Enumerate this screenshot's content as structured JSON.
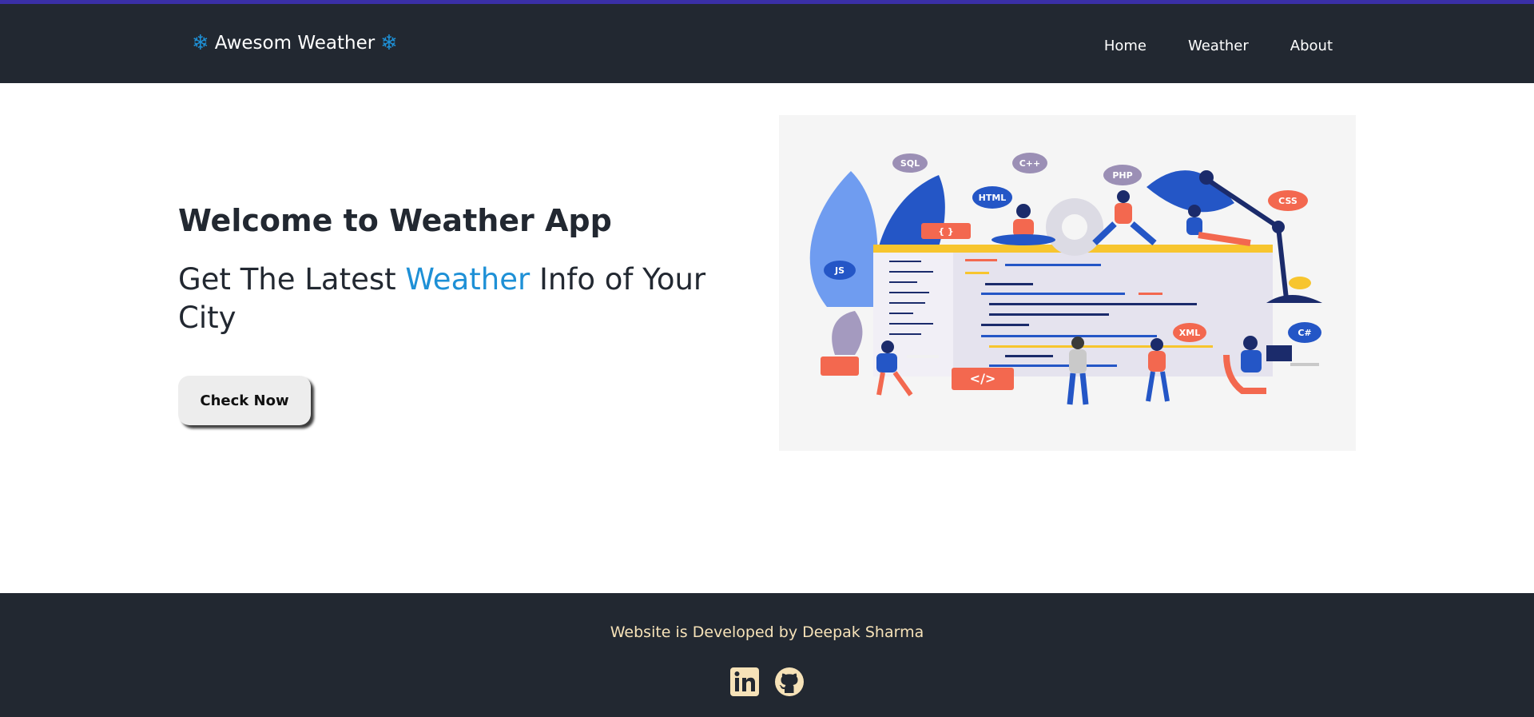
{
  "header": {
    "brand": "Awesom Weather",
    "brand_icon": "snowflake-icon",
    "nav": [
      {
        "label": "Home"
      },
      {
        "label": "Weather"
      },
      {
        "label": "About"
      }
    ]
  },
  "hero": {
    "title": "Welcome to Weather App",
    "subtitle_before": "Get The Latest ",
    "subtitle_accent": "Weather",
    "subtitle_after": " Info of Your City",
    "button": "Check Now"
  },
  "illustration": {
    "tags": [
      "SQL",
      "C++",
      "PHP",
      "HTML",
      "CSS",
      "JS",
      "C#",
      "XML",
      "{ }",
      "</>"
    ]
  },
  "footer": {
    "credit": "Website is Developed by Deepak Sharma",
    "icons": [
      "linkedin-icon",
      "github-icon"
    ]
  },
  "colors": {
    "header_bg": "#222831",
    "accent": "#1e90d6",
    "top_bar": "#3a2fa6",
    "footer_text": "#f6e2b8"
  }
}
